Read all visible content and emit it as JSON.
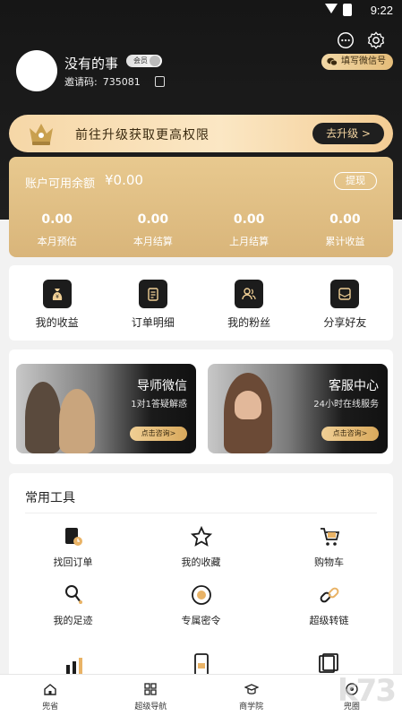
{
  "status_bar": {
    "time": "9:22"
  },
  "header_icons": [
    "chat-bubble-icon",
    "gear-icon"
  ],
  "user": {
    "name": "没有的事",
    "badge": "会员",
    "invite_label": "邀请码:",
    "invite_code": "735081"
  },
  "wechat_button": "填写微信号",
  "upgrade": {
    "text": "前往升级获取更高权限",
    "button": "去升级 >"
  },
  "balance": {
    "label": "账户可用余额",
    "amount": "¥0.00",
    "withdraw": "提现",
    "stats": [
      {
        "value": "0.00",
        "label": "本月预估"
      },
      {
        "value": "0.00",
        "label": "本月结算"
      },
      {
        "value": "0.00",
        "label": "上月结算"
      },
      {
        "value": "0.00",
        "label": "累计收益"
      }
    ]
  },
  "quick_actions": [
    {
      "label": "我的收益",
      "icon": "money-bag-icon"
    },
    {
      "label": "订单明细",
      "icon": "clipboard-icon"
    },
    {
      "label": "我的粉丝",
      "icon": "fans-icon"
    },
    {
      "label": "分享好友",
      "icon": "share-icon"
    }
  ],
  "promo": [
    {
      "title": "导师微信",
      "subtitle": "1对1答疑解惑",
      "button": "点击咨询>"
    },
    {
      "title": "客服中心",
      "subtitle": "24小时在线服务",
      "button": "点击咨询>"
    }
  ],
  "tools": {
    "heading": "常用工具",
    "items": [
      {
        "label": "找回订单",
        "icon": "find-order-icon"
      },
      {
        "label": "我的收藏",
        "icon": "star-icon"
      },
      {
        "label": "购物车",
        "icon": "cart-icon"
      },
      {
        "label": "我的足迹",
        "icon": "footprint-icon"
      },
      {
        "label": "专属密令",
        "icon": "secret-code-icon"
      },
      {
        "label": "超级转链",
        "icon": "link-icon"
      }
    ]
  },
  "tabbar": [
    {
      "label": "兜省",
      "icon": "home-icon"
    },
    {
      "label": "超级导航",
      "icon": "grid-icon"
    },
    {
      "label": "商学院",
      "icon": "graduation-cap-icon"
    },
    {
      "label": "兜圈",
      "icon": "circle-icon"
    }
  ],
  "watermark": "k73",
  "colors": {
    "gold": "#e3c083",
    "dark": "#1c1c1c"
  }
}
